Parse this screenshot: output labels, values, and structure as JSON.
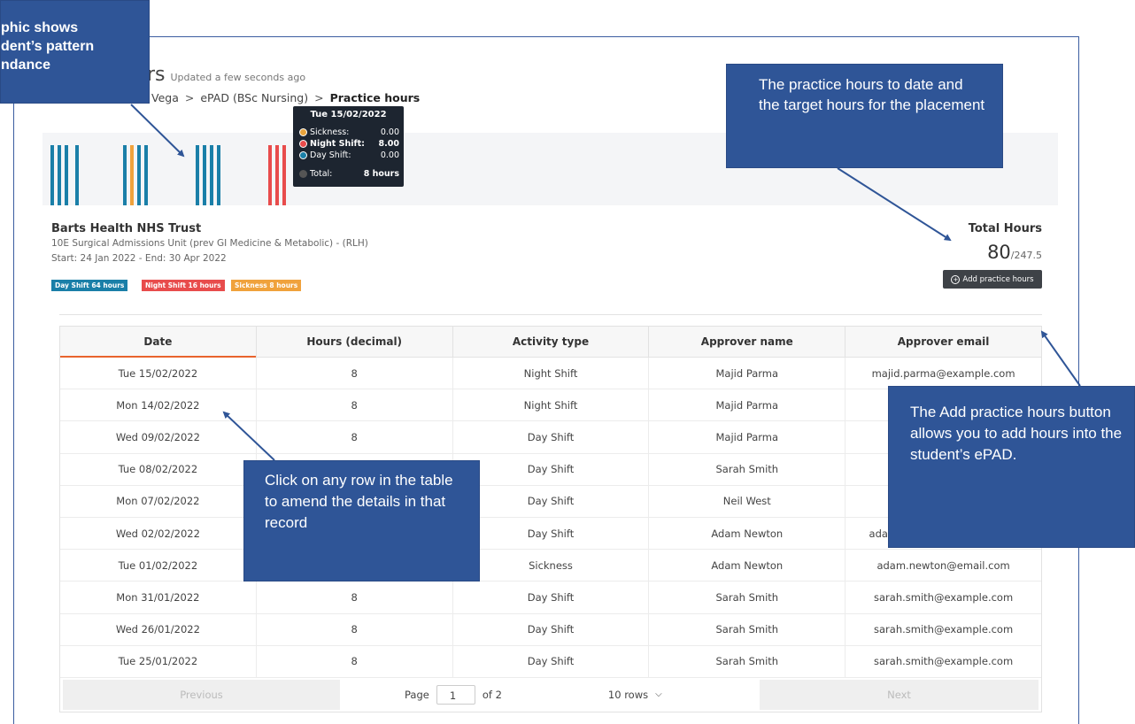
{
  "header": {
    "title": "urs",
    "updated": "Updated a few seconds ago",
    "breadcrumb": [
      "Vega",
      "ePAD (BSc Nursing)",
      "Practice hours"
    ]
  },
  "tooltip": {
    "date": "Tue 15/02/2022",
    "rows": [
      {
        "label": "Sickness:",
        "value": "0.00",
        "color": "#e8a33b"
      },
      {
        "label": "Night Shift:",
        "value": "8.00",
        "color": "#e84c4c"
      },
      {
        "label": "Day Shift:",
        "value": "0.00",
        "color": "#1a7fa8"
      },
      {
        "label": "Total:",
        "value": "8 hours",
        "color": "#555555"
      }
    ]
  },
  "placement": {
    "trust": "Barts Health NHS Trust",
    "unit": "10E Surgical Admissions Unit (prev GI Medicine & Metabolic) - (RLH)",
    "dates": "Start: 24 Jan 2022 - End: 30 Apr 2022",
    "badges": [
      {
        "label": "Day Shift 64 hours",
        "color": "#1a7fa8"
      },
      {
        "label": "Night Shift 16 hours",
        "color": "#e84c4c"
      },
      {
        "label": "Sickness 8 hours",
        "color": "#f0a23c"
      }
    ]
  },
  "totals": {
    "label": "Total Hours",
    "hours": "80",
    "target": "/247.5",
    "add_button": "Add practice hours"
  },
  "table": {
    "headers": [
      "Date",
      "Hours (decimal)",
      "Activity type",
      "Approver name",
      "Approver email"
    ],
    "rows": [
      [
        "Tue 15/02/2022",
        "8",
        "Night Shift",
        "Majid Parma",
        "majid.parma@example.com"
      ],
      [
        "Mon 14/02/2022",
        "8",
        "Night Shift",
        "Majid Parma",
        "ma"
      ],
      [
        "Wed 09/02/2022",
        "8",
        "Day Shift",
        "Majid Parma",
        "ma"
      ],
      [
        "Tue 08/02/2022",
        "",
        "Day Shift",
        "Sarah Smith",
        "sar"
      ],
      [
        "Mon 07/02/2022",
        "",
        "Day Shift",
        "Neil West",
        "n"
      ],
      [
        "Wed 02/02/2022",
        "",
        "Day Shift",
        "Adam Newton",
        "adam.newton@example.com"
      ],
      [
        "Tue 01/02/2022",
        "8",
        "Sickness",
        "Adam Newton",
        "adam.newton@email.com"
      ],
      [
        "Mon 31/01/2022",
        "8",
        "Day Shift",
        "Sarah Smith",
        "sarah.smith@example.com"
      ],
      [
        "Wed 26/01/2022",
        "8",
        "Day Shift",
        "Sarah Smith",
        "sarah.smith@example.com"
      ],
      [
        "Tue 25/01/2022",
        "8",
        "Day Shift",
        "Sarah Smith",
        "sarah.smith@example.com"
      ]
    ]
  },
  "pager": {
    "previous": "Previous",
    "page_label": "Page",
    "page_value": "1",
    "of_label": "of 2",
    "rows_option": "10 rows",
    "next": "Next"
  },
  "callouts": {
    "graphic": [
      "phic shows",
      "dent’s pattern",
      "ndance"
    ],
    "practice_hours": "The practice hours to date and the target hours for the placement",
    "click_row": "Click on any row in the table to amend the details in that record",
    "add_hours": "The Add practice hours button allows you to add hours into the student’s ePAD."
  },
  "colors": {
    "day_shift": "#1a7fa8",
    "night_shift": "#e84c4c",
    "sickness": "#f0a23c",
    "callout": "#2f5597",
    "sort_accent": "#e8632c"
  }
}
